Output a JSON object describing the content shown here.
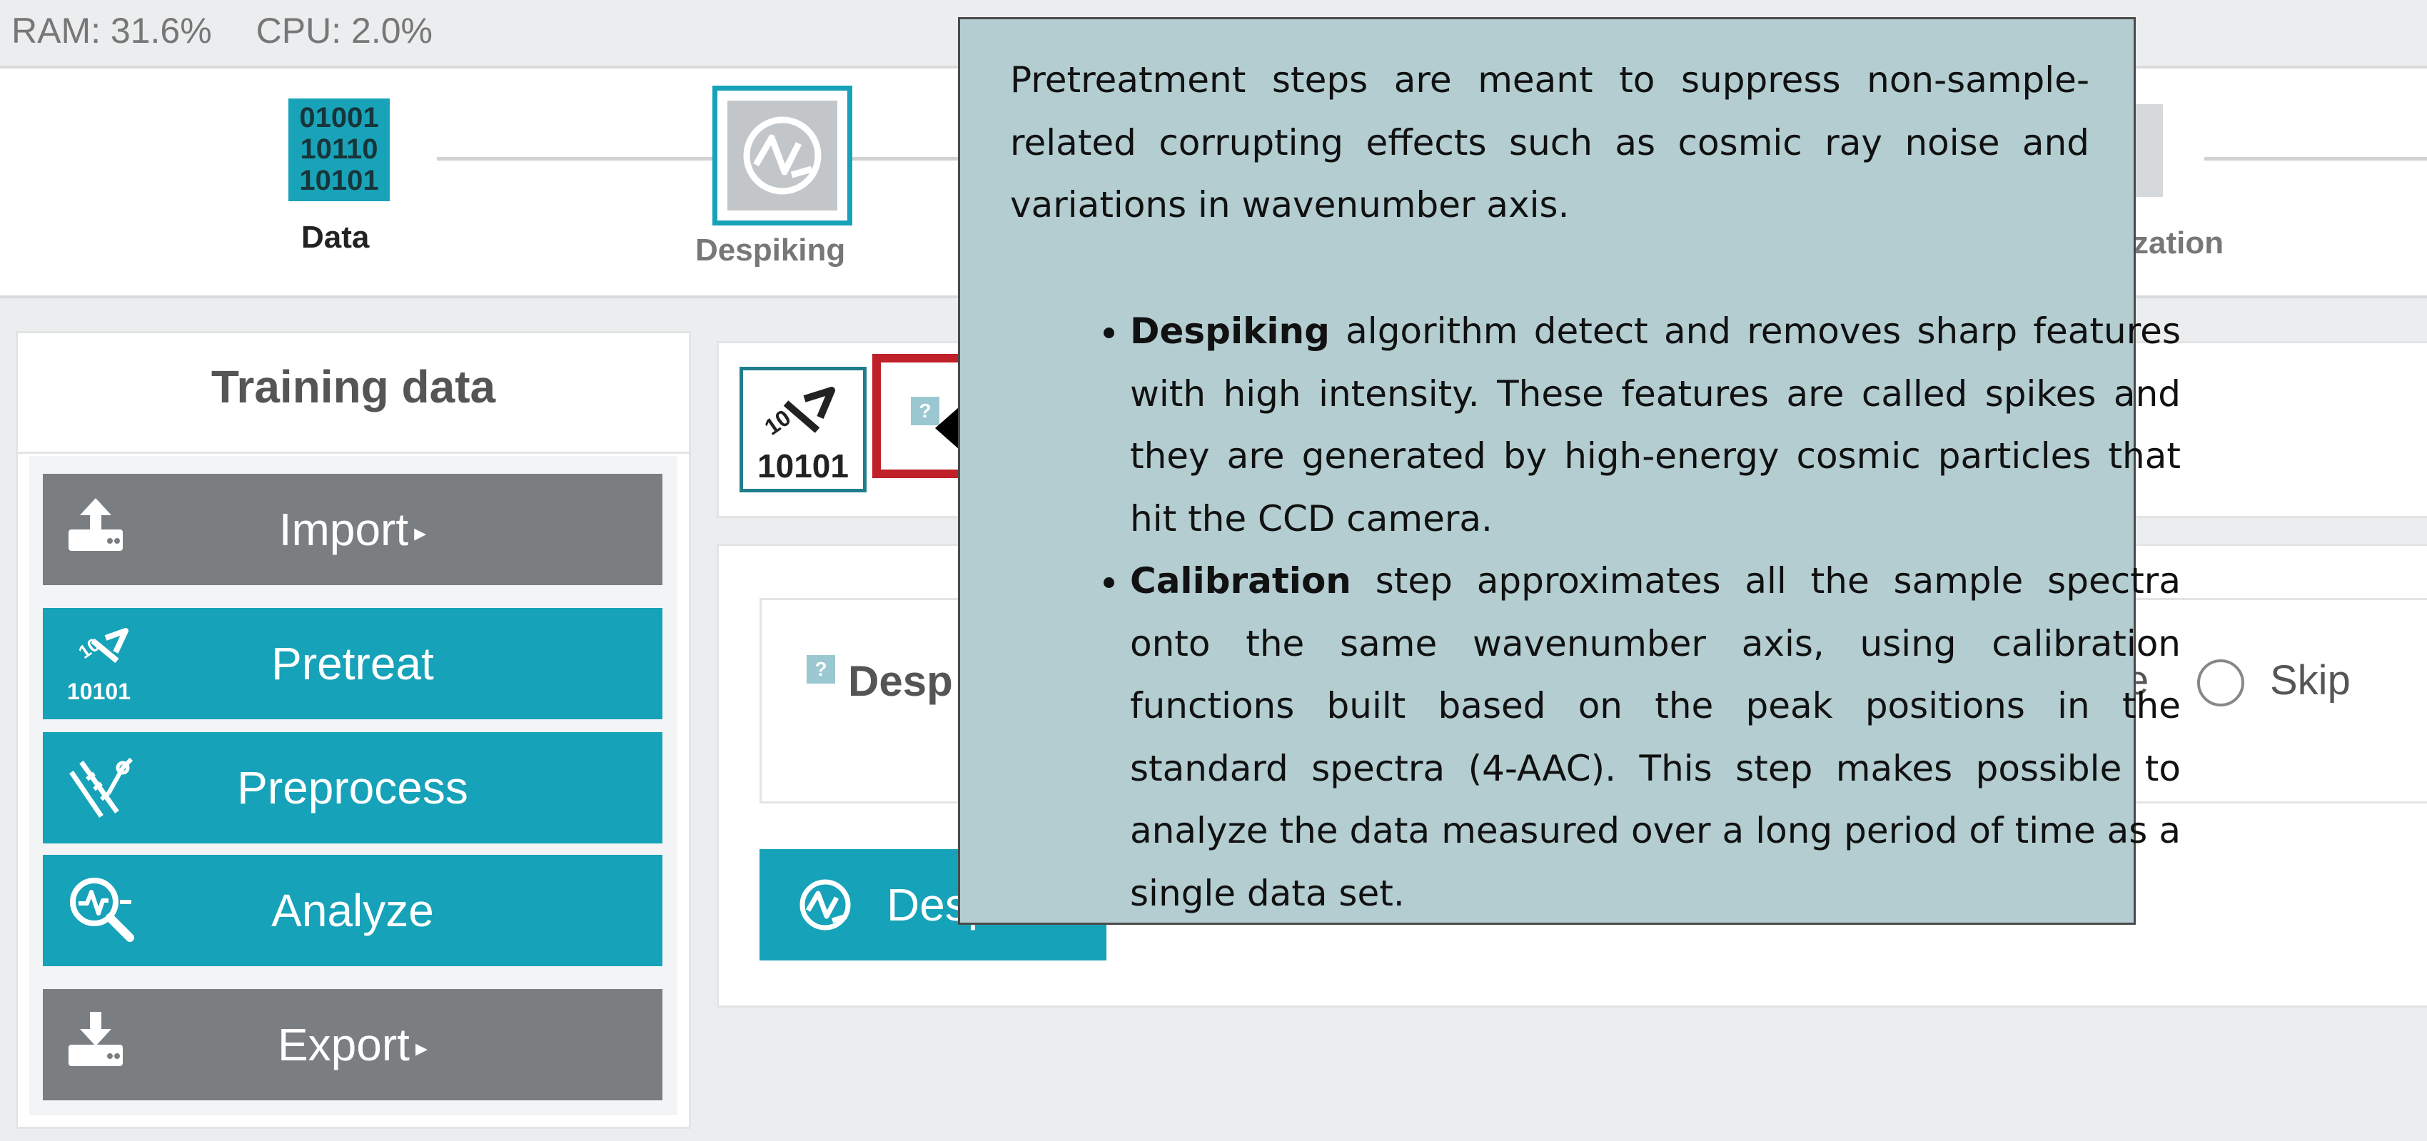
{
  "status": {
    "ram": "RAM: 31.6%",
    "cpu": "CPU: 2.0%"
  },
  "pipeline": {
    "steps": [
      {
        "label": "Data",
        "icon": "binary-data-icon",
        "state": "done"
      },
      {
        "label": "Despiking",
        "icon": "despiking-icon",
        "state": "active"
      },
      {
        "label": "zation",
        "icon": "step-icon",
        "state": "pending"
      }
    ],
    "data_icon_text": [
      "01001",
      "10110",
      "10101"
    ]
  },
  "sidebar": {
    "title": "Training data",
    "buttons": [
      {
        "label": "Import",
        "icon": "upload-icon",
        "submenu": true,
        "color": "#7a7e80"
      },
      {
        "label": "Pretreat",
        "icon": "pretreat-icon",
        "submenu": false,
        "color": "#16a2b8"
      },
      {
        "label": "Preprocess",
        "icon": "preprocess-icon",
        "submenu": false,
        "color": "#16a2b8"
      },
      {
        "label": "Analyze",
        "icon": "analyze-icon",
        "submenu": false,
        "color": "#16a2b8"
      },
      {
        "label": "Export",
        "icon": "download-icon",
        "submenu": true,
        "color": "#7a7e80"
      }
    ],
    "submenu_arrow": "▸",
    "pretreat_icon_text": "10101"
  },
  "main": {
    "pretreat_icon_text": "10101",
    "help_mark": "?",
    "despiking_label": "Desp",
    "option_fragment": "e",
    "skip_label": "Skip",
    "despike_button_label": "Desp"
  },
  "tooltip": {
    "intro": "Pretreatment steps are meant to suppress non-sample-related corrupting effects such as cosmic ray noise and variations in wavenumber axis.",
    "items": [
      {
        "term": "Despiking",
        "text": " algorithm detect and removes sharp features with high intensity. These features are called spikes and they are generated by high-energy cosmic particles that hit the CCD camera."
      },
      {
        "term": "Calibration",
        "text": " step approximates all the sample spectra onto the same wavenumber axis, using calibration functions built based on the peak positions in the standard spectra (4-AAC). This step makes possible to analyze the data measured over a long period of time as a single data set."
      }
    ]
  },
  "colors": {
    "accent": "#16a2b8",
    "gray_button": "#7a7e80",
    "tooltip_bg": "#b3cdd1",
    "highlight": "#c0202a"
  }
}
